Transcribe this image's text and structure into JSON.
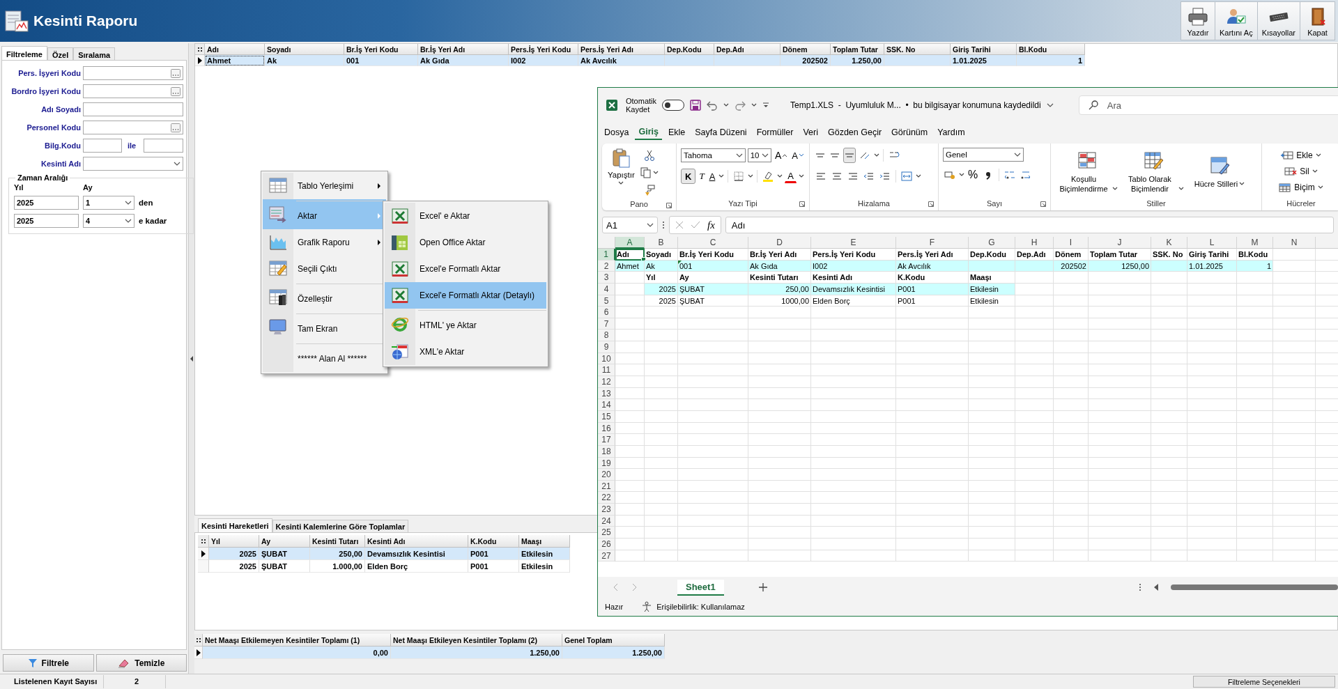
{
  "window": {
    "title": "Kesinti Raporu"
  },
  "toolbar": [
    {
      "label": "Yazdır",
      "kind": "print"
    },
    {
      "label": "Kartını Aç",
      "kind": "card"
    },
    {
      "label": "Kısayollar",
      "kind": "shortcut"
    },
    {
      "label": "Kapat",
      "kind": "close"
    }
  ],
  "filter_tabs": [
    {
      "label": "Filtreleme",
      "selected": true
    },
    {
      "label": "Özel",
      "selected": false
    },
    {
      "label": "Sıralama",
      "selected": false
    }
  ],
  "filters": [
    {
      "label": "Pers. İşyeri Kodu",
      "kind": "lookup"
    },
    {
      "label": "Bordro İşyeri Kodu",
      "kind": "lookup"
    },
    {
      "label": "Adı Soyadı",
      "kind": "text"
    },
    {
      "label": "Personel Kodu",
      "kind": "lookup"
    },
    {
      "label": "Bilg.Kodu",
      "kind": "range",
      "separator": "ile"
    },
    {
      "label": "Kesinti Adı",
      "kind": "dropdown"
    }
  ],
  "time_range": {
    "title": "Zaman Aralığı",
    "year_label": "Yıl",
    "month_label": "Ay",
    "rows": [
      {
        "year": "2025",
        "month": "1",
        "suffix": "den"
      },
      {
        "year": "2025",
        "month": "4",
        "suffix": "e kadar"
      }
    ]
  },
  "filter_buttons": [
    {
      "label": "Filtrele",
      "kind": "filter"
    },
    {
      "label": "Temizle",
      "kind": "clear"
    }
  ],
  "main_grid": {
    "columns": [
      {
        "label": "Adı",
        "numeric": false
      },
      {
        "label": "Soyadı",
        "numeric": false
      },
      {
        "label": "Br.İş Yeri Kodu",
        "numeric": false
      },
      {
        "label": "Br.İş Yeri Adı",
        "numeric": false
      },
      {
        "label": "Pers.İş Yeri Kodu",
        "numeric": false
      },
      {
        "label": "Pers.İş Yeri Adı",
        "numeric": false
      },
      {
        "label": "Dep.Kodu",
        "numeric": false
      },
      {
        "label": "Dep.Adı",
        "numeric": false
      },
      {
        "label": "Dönem",
        "numeric": true
      },
      {
        "label": "Toplam Tutar",
        "numeric": true
      },
      {
        "label": "SSK. No",
        "numeric": false
      },
      {
        "label": "Giriş Tarihi",
        "numeric": false
      },
      {
        "label": "Bl.Kodu",
        "numeric": true
      }
    ],
    "rows": [
      {
        "selected": true,
        "cells": [
          "Ahmet",
          "Ak",
          "001",
          "Ak Gıda",
          "I002",
          "Ak Avcılık",
          null,
          null,
          "202502",
          "1.250,00",
          null,
          "1.01.2025",
          "1"
        ]
      }
    ]
  },
  "context_menu": {
    "items": [
      {
        "label": "Tablo Yerleşimi",
        "kind": "layout",
        "submenu": true,
        "selected": false,
        "separator_before": false
      },
      {
        "label": "Aktar",
        "kind": "export",
        "submenu": true,
        "selected": true,
        "separator_before": true
      },
      {
        "label": "Grafik Raporu",
        "kind": "chart",
        "submenu": true,
        "selected": false,
        "separator_before": false
      },
      {
        "label": "Seçili Çıktı",
        "kind": "selection",
        "submenu": false,
        "selected": false,
        "separator_before": false
      },
      {
        "label": "Özelleştir",
        "kind": "customize",
        "submenu": false,
        "selected": false,
        "separator_before": true
      },
      {
        "label": "Tam Ekran",
        "kind": "fullscreen",
        "submenu": false,
        "selected": false,
        "separator_before": true
      },
      {
        "label": "****** Alan Al ******",
        "kind": "plain",
        "submenu": false,
        "selected": false,
        "separator_before": true
      }
    ],
    "submenu": [
      {
        "label": "Excel' e Aktar",
        "kind": "excel",
        "selected": false,
        "separator_before": false
      },
      {
        "label": "Open Office Aktar",
        "kind": "office",
        "selected": false,
        "separator_before": false
      },
      {
        "label": "Excel'e Formatlı Aktar",
        "kind": "excel",
        "selected": false,
        "separator_before": false
      },
      {
        "label": "Excel'e Formatlı Aktar (Detaylı)",
        "kind": "excel",
        "selected": true,
        "separator_before": false
      },
      {
        "label": "HTML' ye Aktar",
        "kind": "html",
        "selected": false,
        "separator_before": true
      },
      {
        "label": "XML'e Aktar",
        "kind": "xml",
        "selected": false,
        "separator_before": false
      }
    ]
  },
  "detail_tabs": [
    {
      "label": "Kesinti Hareketleri",
      "selected": true
    },
    {
      "label": "Kesinti Kalemlerine Göre Toplamlar",
      "selected": false
    }
  ],
  "detail_grid": {
    "columns": [
      {
        "label": "Yıl",
        "numeric": true
      },
      {
        "label": "Ay",
        "numeric": false
      },
      {
        "label": "Kesinti Tutarı",
        "numeric": true
      },
      {
        "label": "Kesinti Adı",
        "numeric": false
      },
      {
        "label": "K.Kodu",
        "numeric": false
      },
      {
        "label": "Maaşı",
        "numeric": false
      }
    ],
    "rows": [
      {
        "selected": true,
        "cells": [
          "2025",
          "ŞUBAT",
          "250,00",
          "Devamsızlık Kesintisi",
          "P001",
          "Etkilesin"
        ]
      },
      {
        "selected": false,
        "cells": [
          "2025",
          "ŞUBAT",
          "1.000,00",
          "Elden Borç",
          "P001",
          "Etkilesin"
        ]
      }
    ]
  },
  "summary_grid": {
    "columns": [
      {
        "label": "Net Maaşı Etkilemeyen Kesintiler Toplamı (1)",
        "numeric": true
      },
      {
        "label": "Net Maaşı Etkileyen Kesintiler Toplamı (2)",
        "numeric": true
      },
      {
        "label": "Genel Toplam",
        "numeric": true
      }
    ],
    "rows": [
      {
        "selected": true,
        "cells": [
          "0,00",
          "1.250,00",
          "1.250,00"
        ]
      }
    ]
  },
  "status_bar": {
    "count_label": "Listelenen Kayıt Sayısı",
    "count": "2",
    "options_button": "Filtreleme Seçenekleri"
  },
  "excel": {
    "autosave": {
      "label": "Otomatik Kaydet",
      "on": false
    },
    "title": "Temp1.XLS  -  Uyumluluk M...  •  bu bilgisayar konumuna kaydedildi",
    "search": {
      "placeholder": "Ara"
    },
    "ribbon_tabs": [
      {
        "label": "Dosya",
        "selected": false
      },
      {
        "label": "Giriş",
        "selected": true
      },
      {
        "label": "Ekle",
        "selected": false
      },
      {
        "label": "Sayfa Düzeni",
        "selected": false
      },
      {
        "label": "Formüller",
        "selected": false
      },
      {
        "label": "Veri",
        "selected": false
      },
      {
        "label": "Gözden Geçir",
        "selected": false
      },
      {
        "label": "Görünüm",
        "selected": false
      },
      {
        "label": "Yardım",
        "selected": false
      }
    ],
    "clipboard": {
      "label": "Pano",
      "paste": "Yapıştır"
    },
    "font": {
      "label": "Yazı Tipi",
      "name": "Tahoma",
      "size": "10",
      "grow": "A",
      "shrink": "A",
      "bold": "K",
      "italic": "T",
      "underline": "A",
      "color_label": "A"
    },
    "alignment": {
      "label": "Hizalama"
    },
    "number": {
      "label": "Sayı",
      "format": "Genel",
      "percent": "%"
    },
    "styles": {
      "label": "Stiller",
      "buttons": [
        {
          "label": "Koşullu Biçimlendirme",
          "kind": "conditional"
        },
        {
          "label": "Tablo Olarak Biçimlendir",
          "kind": "table"
        },
        {
          "label": "Hücre Stilleri",
          "kind": "styles"
        }
      ]
    },
    "cells": {
      "label": "Hücreler",
      "buttons": [
        {
          "label": "Ekle",
          "kind": "insert"
        },
        {
          "label": "Sil",
          "kind": "delete"
        },
        {
          "label": "Biçim",
          "kind": "format"
        }
      ]
    },
    "name_box": "A1",
    "function_label": "fx",
    "formula": "Adı",
    "columns": [
      {
        "label": "A",
        "selected": true
      },
      {
        "label": "B",
        "selected": false
      },
      {
        "label": "C",
        "selected": false
      },
      {
        "label": "D",
        "selected": false
      },
      {
        "label": "E",
        "selected": false
      },
      {
        "label": "F",
        "selected": false
      },
      {
        "label": "G",
        "selected": false
      },
      {
        "label": "H",
        "selected": false
      },
      {
        "label": "I",
        "selected": false
      },
      {
        "label": "J",
        "selected": false
      },
      {
        "label": "K",
        "selected": false
      },
      {
        "label": "L",
        "selected": false
      },
      {
        "label": "M",
        "selected": false
      },
      {
        "label": "N",
        "selected": false
      }
    ],
    "rows": [
      {
        "number": "1",
        "selected": true,
        "bold": true,
        "highlighted": false,
        "cells": {
          "A": {
            "text": "Adı"
          },
          "B": {
            "text": "Soyadı"
          },
          "C": {
            "text": "Br.İş Yeri Kodu"
          },
          "D": {
            "text": "Br.İş Yeri Adı"
          },
          "E": {
            "text": "Pers.İş Yeri Kodu"
          },
          "F": {
            "text": "Pers.İş Yeri Adı"
          },
          "G": {
            "text": "Dep.Kodu"
          },
          "H": {
            "text": "Dep.Adı"
          },
          "I": {
            "text": "Dönem"
          },
          "J": {
            "text": "Toplam Tutar"
          },
          "K": {
            "text": "SSK. No"
          },
          "L": {
            "text": "Giriş Tarihi"
          },
          "M": {
            "text": "Bl.Kodu"
          }
        }
      },
      {
        "number": "2",
        "selected": false,
        "bold": false,
        "highlighted": true,
        "cells": {
          "A": {
            "text": "Ahmet"
          },
          "B": {
            "text": "Ak"
          },
          "C": {
            "text": "001",
            "warning": true
          },
          "D": {
            "text": "Ak Gıda"
          },
          "E": {
            "text": "I002"
          },
          "F": {
            "text": "Ak Avcılık"
          },
          "I": {
            "text": "202502",
            "numeric": true
          },
          "J": {
            "text": "1250,00",
            "numeric": true
          },
          "L": {
            "text": "1.01.2025"
          },
          "M": {
            "text": "1",
            "numeric": true
          }
        }
      },
      {
        "number": "3",
        "selected": false,
        "bold": true,
        "highlighted": false,
        "cells": {
          "B": {
            "text": "Yıl"
          },
          "C": {
            "text": "Ay"
          },
          "D": {
            "text": "Kesinti Tutarı"
          },
          "E": {
            "text": "Kesinti Adı"
          },
          "F": {
            "text": "K.Kodu"
          },
          "G": {
            "text": "Maaşı"
          }
        }
      },
      {
        "number": "4",
        "selected": false,
        "bold": false,
        "highlighted": true,
        "cells": {
          "B": {
            "text": "2025",
            "numeric": true
          },
          "C": {
            "text": "ŞUBAT"
          },
          "D": {
            "text": "250,00",
            "numeric": true
          },
          "E": {
            "text": "Devamsızlık Kesintisi"
          },
          "F": {
            "text": "P001"
          },
          "G": {
            "text": "Etkilesin"
          }
        }
      },
      {
        "number": "5",
        "selected": false,
        "bold": false,
        "highlighted": false,
        "cells": {
          "B": {
            "text": "2025",
            "numeric": true
          },
          "C": {
            "text": "ŞUBAT"
          },
          "D": {
            "text": "1000,00",
            "numeric": true
          },
          "E": {
            "text": "Elden Borç"
          },
          "F": {
            "text": "P001"
          },
          "G": {
            "text": "Etkilesin"
          }
        }
      },
      {
        "number": "6",
        "selected": false,
        "cells": {}
      },
      {
        "number": "7",
        "selected": false,
        "cells": {}
      },
      {
        "number": "8",
        "selected": false,
        "cells": {}
      },
      {
        "number": "9",
        "selected": false,
        "cells": {}
      },
      {
        "number": "10",
        "selected": false,
        "cells": {}
      },
      {
        "number": "11",
        "selected": false,
        "cells": {}
      },
      {
        "number": "12",
        "selected": false,
        "cells": {}
      },
      {
        "number": "13",
        "selected": false,
        "cells": {}
      },
      {
        "number": "14",
        "selected": false,
        "cells": {}
      },
      {
        "number": "15",
        "selected": false,
        "cells": {}
      },
      {
        "number": "16",
        "selected": false,
        "cells": {}
      },
      {
        "number": "17",
        "selected": false,
        "cells": {}
      },
      {
        "number": "18",
        "selected": false,
        "cells": {}
      },
      {
        "number": "19",
        "selected": false,
        "cells": {}
      },
      {
        "number": "20",
        "selected": false,
        "cells": {}
      },
      {
        "number": "21",
        "selected": false,
        "cells": {}
      },
      {
        "number": "22",
        "selected": false,
        "cells": {}
      },
      {
        "number": "23",
        "selected": false,
        "cells": {}
      },
      {
        "number": "24",
        "selected": false,
        "cells": {}
      },
      {
        "number": "25",
        "selected": false,
        "cells": {}
      },
      {
        "number": "26",
        "selected": false,
        "cells": {}
      },
      {
        "number": "27",
        "selected": false,
        "cells": {}
      }
    ],
    "sheet_tabs": [
      {
        "label": "Sheet1",
        "selected": true
      }
    ],
    "status": {
      "ready": "Hazır",
      "accessibility": "Erişilebilirlik: Kullanılamaz"
    }
  }
}
